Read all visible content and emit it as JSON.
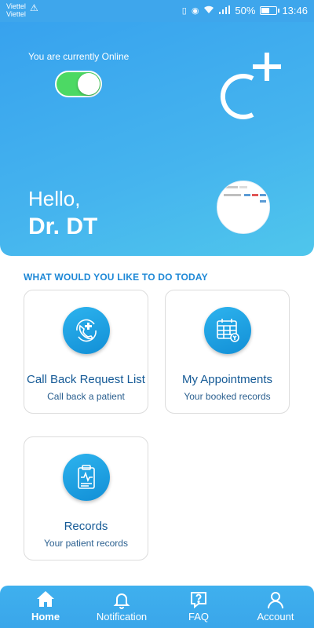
{
  "status_bar": {
    "carrier_1": "Viettel",
    "carrier_2": "Viettel",
    "battery": "50%",
    "time": "13:46"
  },
  "header": {
    "online_status": "You are currently Online",
    "greeting": "Hello,",
    "doctor_name": "Dr. DT",
    "toggle_on": true
  },
  "section_title": "WHAT WOULD YOU LIKE TO DO TODAY",
  "cards": [
    {
      "title": "Call Back Request List",
      "subtitle": "Call back a patient",
      "icon": "phone-callback-icon"
    },
    {
      "title": "My Appointments",
      "subtitle": "Your booked records",
      "icon": "calendar-icon"
    },
    {
      "title": "Records",
      "subtitle": "Your patient records",
      "icon": "clipboard-icon"
    }
  ],
  "nav": [
    {
      "label": "Home",
      "icon": "home-icon",
      "active": true
    },
    {
      "label": "Notification",
      "icon": "bell-icon",
      "active": false
    },
    {
      "label": "FAQ",
      "icon": "faq-icon",
      "active": false
    },
    {
      "label": "Account",
      "icon": "user-icon",
      "active": false
    }
  ],
  "colors": {
    "primary": "#3ea6ec",
    "toggle_on": "#4cd964",
    "accent_text": "#1e88d6",
    "card_title": "#155a96"
  }
}
